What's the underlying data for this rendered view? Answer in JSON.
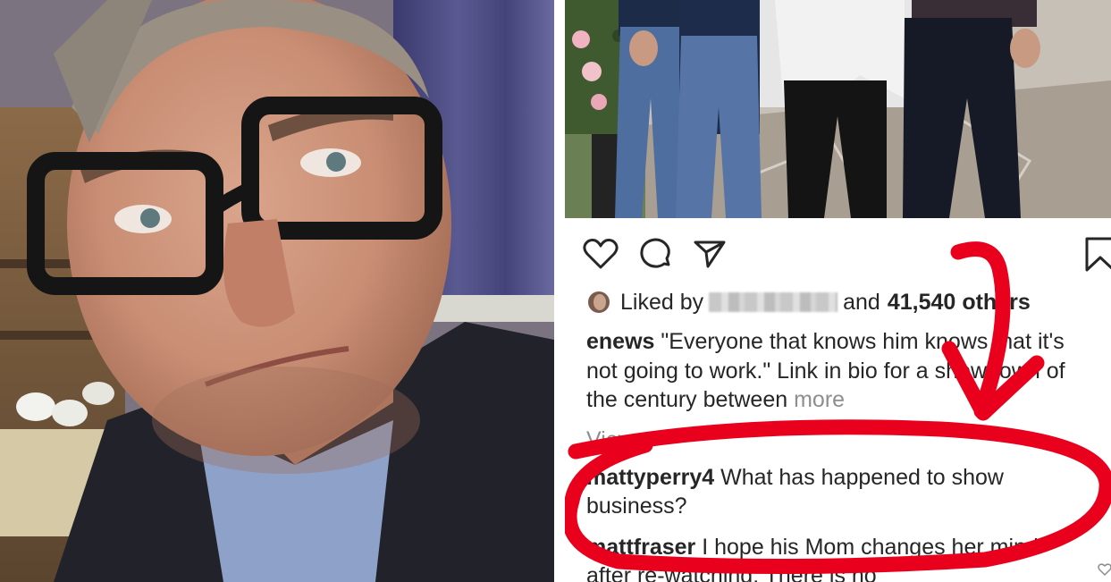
{
  "post": {
    "liked_by_prefix": "Liked by",
    "liked_by_and": "and",
    "likes_count": "41,540",
    "likes_suffix": "others",
    "caption_username": "enews",
    "caption_text": "\"Everyone that knows him knows that it's not going to work.\" Link in bio for a showdown of the century between",
    "caption_more": "more",
    "view_comments": "View all"
  },
  "comments": [
    {
      "username": "mattyperry4",
      "text": "What has happened to show business?"
    },
    {
      "username": "mattfraser",
      "text": "I hope his Mom changes her mind after re-watching. There is no"
    }
  ],
  "icons": [
    "heart-icon",
    "comment-icon",
    "share-icon",
    "bookmark-icon",
    "comment-like-icon"
  ],
  "colors": {
    "text": "#262626",
    "muted": "#8e8e8e",
    "annotation_red": "#e8001c"
  }
}
